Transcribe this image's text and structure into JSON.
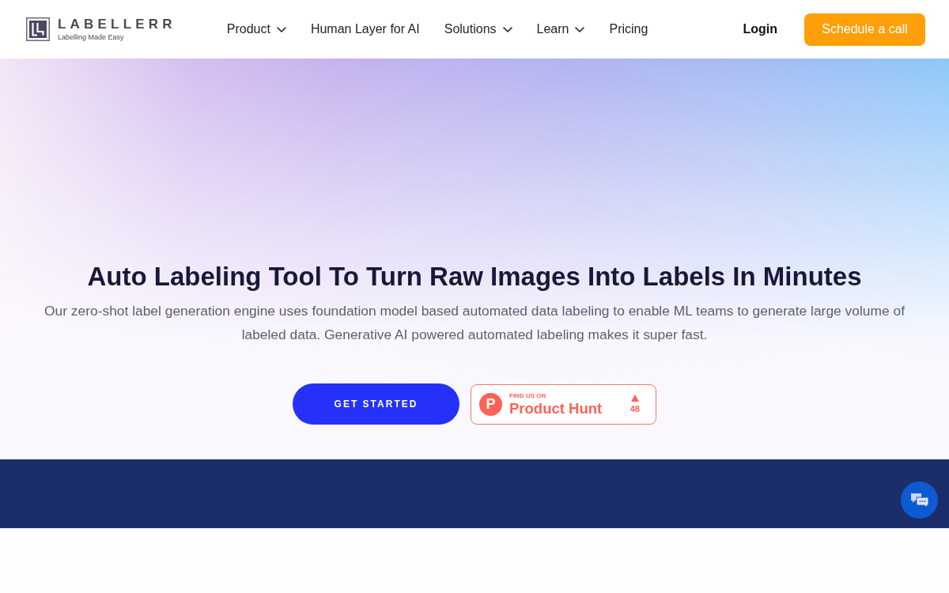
{
  "header": {
    "logo": {
      "name": "LABELLERR",
      "tagline": "Labelling Made Easy"
    },
    "nav": [
      {
        "label": "Product",
        "kind": "dropdown"
      },
      {
        "label": "Human Layer for AI",
        "kind": "link"
      },
      {
        "label": "Solutions",
        "kind": "dropdown"
      },
      {
        "label": "Learn",
        "kind": "dropdown"
      },
      {
        "label": "Pricing",
        "kind": "link"
      }
    ],
    "login": "Login",
    "cta": "Schedule a call"
  },
  "hero": {
    "title": "Auto Labeling Tool To Turn Raw Images Into Labels In Minutes",
    "description": "Our zero-shot label generation engine uses foundation model based automated data labeling to enable ML teams to generate large volume of labeled data. Generative AI powered automated  labeling makes it super fast.",
    "primary_button": "GET STARTED",
    "product_hunt": {
      "logo_letter": "P",
      "eyebrow": "FIND US ON",
      "name": "Product Hunt",
      "votes": "48"
    }
  }
}
